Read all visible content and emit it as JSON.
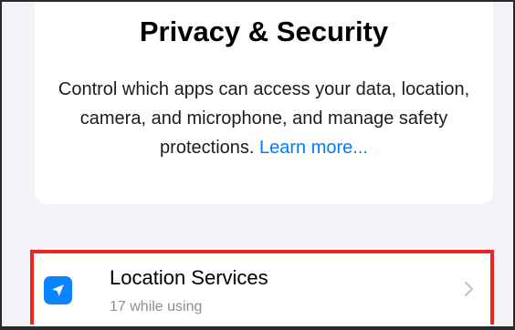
{
  "header": {
    "title": "Privacy & Security",
    "description": "Control which apps can access your data, location, camera, and microphone, and manage safety protections.",
    "learn_more": "Learn more..."
  },
  "list": {
    "items": [
      {
        "title": "Location Services",
        "subtitle": "17 while using",
        "icon": "location-arrow-icon"
      }
    ]
  },
  "colors": {
    "accent": "#007aff",
    "icon_background": "#0a84ff",
    "highlight": "#e8281e",
    "background": "#f2f2f7"
  }
}
